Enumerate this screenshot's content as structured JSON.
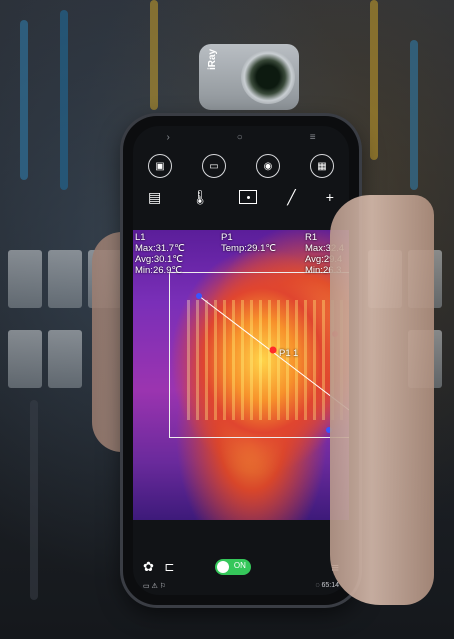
{
  "camera": {
    "brand": "iRay"
  },
  "nav": {
    "back": "›",
    "home": "○",
    "menu": "≡"
  },
  "toolbar1": [
    "screenshot-icon",
    "record-icon",
    "camera-icon",
    "grid-icon"
  ],
  "toolbar2": [
    "calendar-icon",
    "thermometer-icon",
    "spot-icon",
    "line-icon",
    "cross-icon"
  ],
  "overlay": {
    "l1": {
      "title": "L1",
      "max": "Max:31.7℃",
      "avg": "Avg:30.1℃",
      "min": "Min:26.9℃"
    },
    "p1": {
      "title": "P1",
      "temp": "Temp:29.1℃"
    },
    "r1": {
      "title": "R1",
      "max": "Max:32.4",
      "avg": "Avg:29.4",
      "min": "Min:26.3"
    },
    "label_p1": "P1",
    "label_l1": "1"
  },
  "bottom": {
    "toggle_label": "ON"
  },
  "status": {
    "left": "▭ ⚠ ⚐",
    "right": "◌ 65:14"
  },
  "colors": {
    "toggle_on": "#35c75a"
  }
}
